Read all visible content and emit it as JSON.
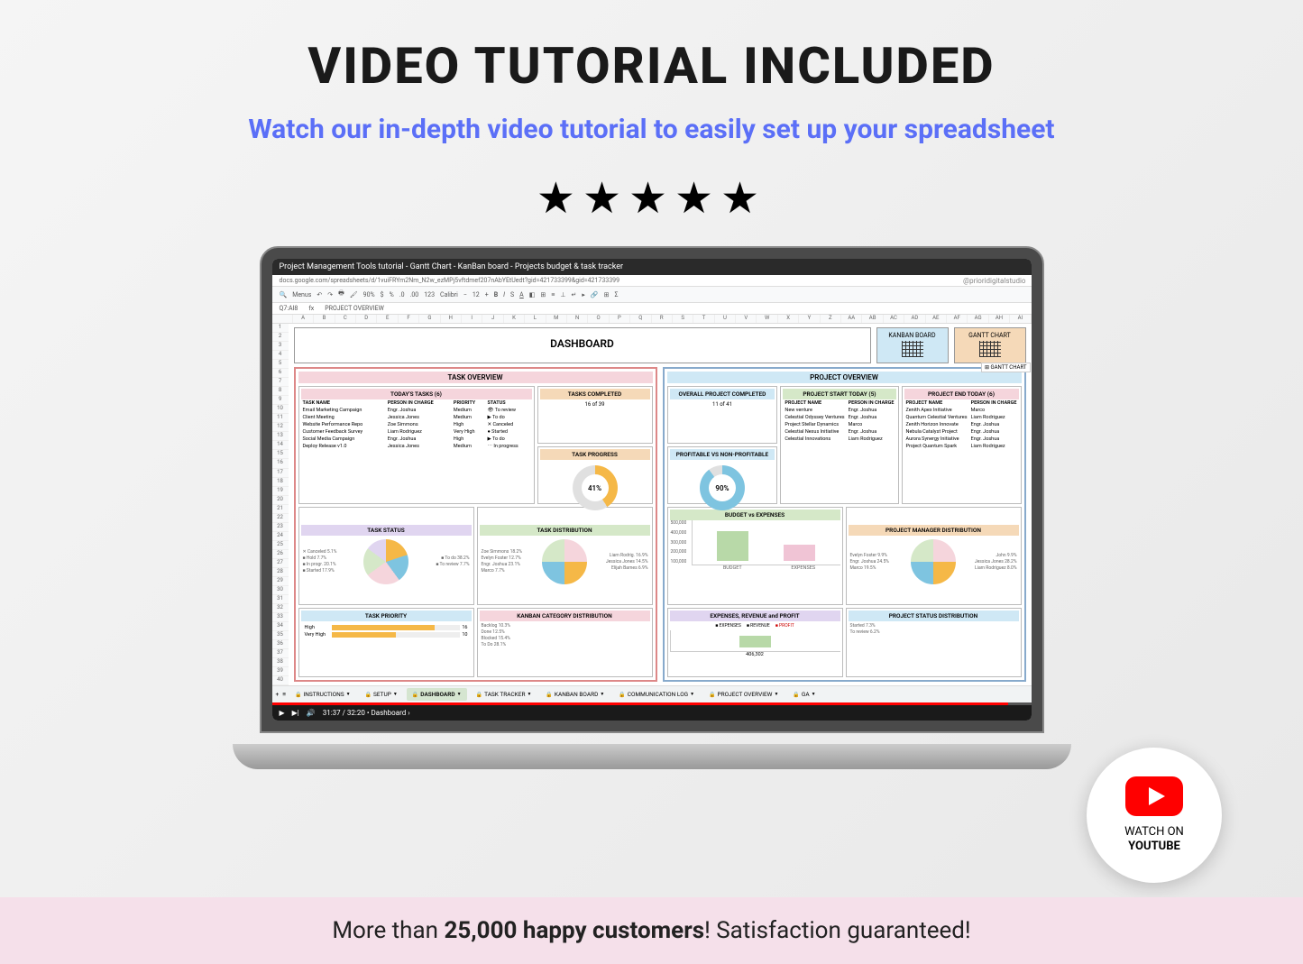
{
  "hero": {
    "title": "VIDEO TUTORIAL INCLUDED",
    "subtitle": "Watch our in-depth video tutorial to easily set up your spreadsheet"
  },
  "video": {
    "title": "Project Management Tools tutorial - Gantt Chart - KanBan board - Projects budget & task tracker",
    "url": "docs.google.com/spreadsheets/d/1vuiFRYm2Nm_N2w_ezMPj5vftdmef207nAbYEtUedt?gid=421733399&gid=421733399",
    "watermark": "@prioridigitalstudio",
    "time": "31:37 / 32:20",
    "chapter": "Dashboard"
  },
  "toolbar": {
    "menus": "Menus",
    "zoom": "90%",
    "font": "Calibri",
    "size": "12",
    "cell": "Q7:AI8",
    "formula": "PROJECT OVERVIEW",
    "cols": [
      "",
      "A",
      "B",
      "C",
      "D",
      "E",
      "F",
      "G",
      "H",
      "I",
      "J",
      "K",
      "L",
      "M",
      "N",
      "O",
      "P",
      "Q",
      "R",
      "S",
      "T",
      "U",
      "V",
      "W",
      "X",
      "Y",
      "Z",
      "AA",
      "AB",
      "AC",
      "AD",
      "AE",
      "AF",
      "AG",
      "AH",
      "AI"
    ]
  },
  "dashboard": {
    "title": "DASHBOARD",
    "kanban_btn": "KANBAN BOARD",
    "gantt_btn": "GANTT CHART",
    "gantt_tooltip": "GANTT CHART"
  },
  "task_overview": {
    "title": "TASK OVERVIEW",
    "todays_tasks": {
      "title": "TODAY'S TASKS (6)",
      "headers": [
        "TASK NAME",
        "PERSON IN CHARGE",
        "PRIORITY",
        "STATUS"
      ],
      "rows": [
        [
          "Email Marketing Campaign",
          "Engr. Joshua",
          "Medium",
          "To review"
        ],
        [
          "Client Meeting",
          "Jessica Jones",
          "Medium",
          "To do"
        ],
        [
          "Website Performance Repo",
          "Zoe Simmons",
          "High",
          "Canceled"
        ],
        [
          "Customer Feedback Survey",
          "Liam Rodriguez",
          "Very High",
          "Started"
        ],
        [
          "Social Media Campaign",
          "Engr. Joshua",
          "High",
          "To do"
        ],
        [
          "Deploy Release v1.0",
          "Jessica Jones",
          "Medium",
          "In progress"
        ]
      ]
    },
    "tasks_completed": {
      "title": "TASKS COMPLETED",
      "value": "16 of 39"
    },
    "task_progress": {
      "title": "TASK PROGRESS",
      "pct": "41%"
    },
    "task_status": {
      "title": "TASK STATUS",
      "legend_left": [
        "✕ Canceled 5.1%",
        "■ Hold 7.7%",
        "■ In progr. 20.1%",
        "■ Started 17.9%"
      ],
      "legend_right": [
        "■ To do 38.2%",
        "■ To review 7.7%"
      ]
    },
    "task_distribution": {
      "title": "TASK DISTRIBUTION",
      "legend_left": [
        "Zoe Simmons 18.2%",
        "Evelyn Foster 12.7%",
        "Engr. Joshua 23.1%",
        "Marco 7.7%"
      ],
      "legend_right": [
        "Liam Rodrig. 16.9%",
        "Jessica Jones 14.5%",
        "Elijah Barnes 6.9%"
      ]
    },
    "task_priority": {
      "title": "TASK PRIORITY",
      "items": [
        [
          "High",
          "16"
        ],
        [
          "Very High",
          "10"
        ]
      ]
    },
    "kanban_dist": {
      "title": "KANBAN CATEGORY DISTRIBUTION",
      "labels": [
        "Backlog 10.3%",
        "Done 12.5%",
        "Blocked 15.4%",
        "To Do 28.1%"
      ]
    }
  },
  "project_overview": {
    "title": "PROJECT OVERVIEW",
    "overall": {
      "title": "OVERALL PROJECT COMPLETED",
      "value": "11 of 41"
    },
    "start_today": {
      "title": "PROJECT START TODAY (5)",
      "headers": [
        "PROJECT NAME",
        "PERSON IN CHARGE"
      ],
      "rows": [
        [
          "New venture",
          "Engr. Joshua"
        ],
        [
          "Celestial Odyssey Ventures",
          "Engr. Joshua"
        ],
        [
          "Project Stellar Dynamics",
          "Marco"
        ],
        [
          "Celestial Nexus Initiative",
          "Engr. Joshua"
        ],
        [
          "Celestial Innovations",
          "Liam Rodriguez"
        ]
      ]
    },
    "end_today": {
      "title": "PROJECT END TODAY (6)",
      "headers": [
        "PROJECT NAME",
        "PERSON IN CHARGE"
      ],
      "rows": [
        [
          "Zenith Apex Initiative",
          "Marco"
        ],
        [
          "Quantum Celestial Ventures",
          "Liam Rodriguez"
        ],
        [
          "Zenith Horizon Innovate",
          "Engr. Joshua"
        ],
        [
          "Nebula Catalyst Project",
          "Engr. Joshua"
        ],
        [
          "Aurora Synergy Initiative",
          "Engr. Joshua"
        ],
        [
          "Project Quantum Spark",
          "Liam Rodriguez"
        ]
      ]
    },
    "profitable": {
      "title": "PROFITABLE VS NON-PROFITABLE",
      "pct": "90%"
    },
    "budget_expenses": {
      "title": "BUDGET vs EXPENSES",
      "labels": [
        "BUDGET",
        "EXPENSES"
      ]
    },
    "manager_dist": {
      "title": "PROJECT MANAGER DISTRIBUTION",
      "legend_left": [
        "Evelyn Foster 9.9%",
        "Engr. Joshua 24.5%",
        "Marco 19.5%"
      ],
      "legend_right": [
        "John 9.9%",
        "Jessica Jones 28.2%",
        "Liam Rodriguez 8.0%"
      ]
    },
    "erp": {
      "title": "EXPENSES, REVENUE and PROFIT",
      "legend": [
        "EXPENSES",
        "REVENUE",
        "PROFIT"
      ],
      "value": "406,302"
    },
    "status_dist": {
      "title": "PROJECT STATUS DISTRIBUTION",
      "labels": [
        "Started 7.3%",
        "To review 6.2%"
      ]
    }
  },
  "chart_data": [
    {
      "type": "donut",
      "name": "task_progress",
      "value": 41,
      "max": 100,
      "title": "TASK PROGRESS"
    },
    {
      "type": "donut",
      "name": "profitable",
      "value": 90,
      "max": 100,
      "title": "PROFITABLE VS NON-PROFITABLE"
    },
    {
      "type": "bar",
      "name": "budget_vs_expenses",
      "categories": [
        "BUDGET",
        "EXPENSES"
      ],
      "values": [
        450000,
        260000
      ],
      "ylim": [
        0,
        500000
      ],
      "yticks": [
        100000,
        200000,
        300000,
        400000,
        500000
      ]
    },
    {
      "type": "pie",
      "name": "task_status",
      "series": [
        {
          "name": "Canceled",
          "value": 5.1
        },
        {
          "name": "Hold",
          "value": 7.7
        },
        {
          "name": "In progress",
          "value": 20.1
        },
        {
          "name": "Started",
          "value": 17.9
        },
        {
          "name": "To do",
          "value": 38.2
        },
        {
          "name": "To review",
          "value": 7.7
        }
      ]
    },
    {
      "type": "pie",
      "name": "task_distribution",
      "series": [
        {
          "name": "Zoe Simmons",
          "value": 18.2
        },
        {
          "name": "Evelyn Foster",
          "value": 12.7
        },
        {
          "name": "Engr. Joshua",
          "value": 23.1
        },
        {
          "name": "Marco",
          "value": 7.7
        },
        {
          "name": "Liam Rodriguez",
          "value": 16.9
        },
        {
          "name": "Jessica Jones",
          "value": 14.5
        },
        {
          "name": "Elijah Barnes",
          "value": 6.9
        }
      ]
    },
    {
      "type": "pie",
      "name": "project_manager_distribution",
      "series": [
        {
          "name": "Evelyn Foster",
          "value": 9.9
        },
        {
          "name": "Engr. Joshua",
          "value": 24.5
        },
        {
          "name": "Marco",
          "value": 19.5
        },
        {
          "name": "John",
          "value": 9.9
        },
        {
          "name": "Jessica Jones",
          "value": 28.2
        },
        {
          "name": "Liam Rodriguez",
          "value": 8.0
        }
      ]
    },
    {
      "type": "bar",
      "name": "task_priority",
      "categories": [
        "High",
        "Very High"
      ],
      "values": [
        16,
        10
      ]
    }
  ],
  "tabs": {
    "items": [
      "INSTRUCTIONS",
      "SETUP",
      "DASHBOARD",
      "TASK TRACKER",
      "KANBAN BOARD",
      "COMMUNICATION LOG",
      "PROJECT OVERVIEW",
      "GA"
    ],
    "active": 2
  },
  "youtube": {
    "line1": "WATCH ON",
    "line2": "YOUTUBE"
  },
  "footer": {
    "before": "More than ",
    "bold": "25,000 happy customers",
    "after": "! Satisfaction guaranteed!"
  }
}
